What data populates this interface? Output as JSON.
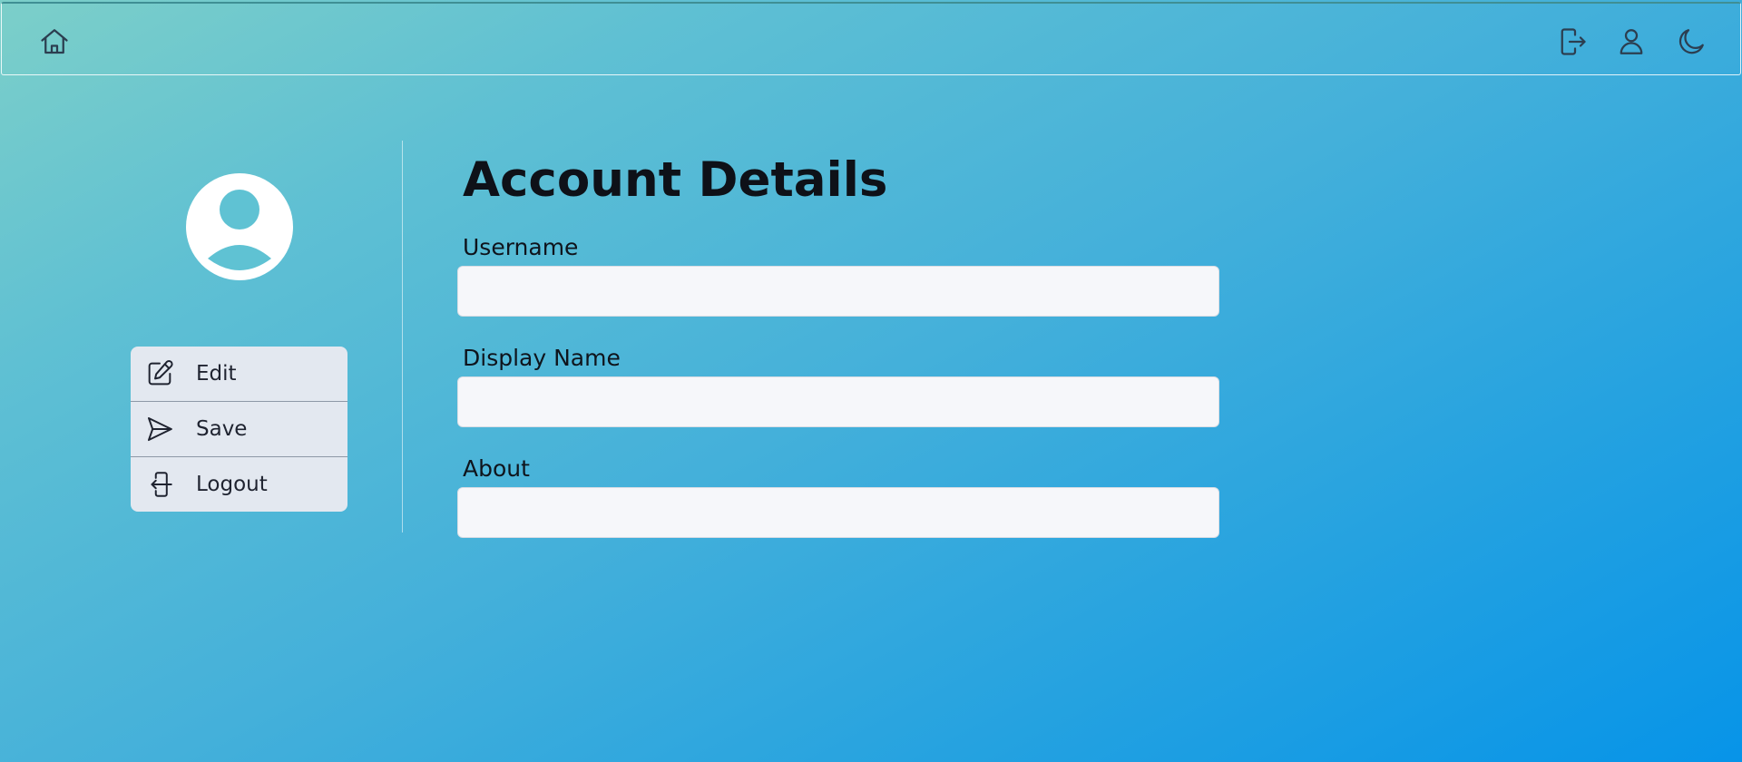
{
  "topbar": {
    "home_icon": "home-icon",
    "right_icons": [
      "logout-icon",
      "user-icon",
      "moon-icon"
    ]
  },
  "sidebar": {
    "avatar_icon": "user-circle-icon",
    "menu": [
      {
        "label": "Edit",
        "icon": "pencil-square-icon"
      },
      {
        "label": "Save",
        "icon": "send-icon"
      },
      {
        "label": "Logout",
        "icon": "logout-arrow-icon"
      }
    ]
  },
  "main": {
    "title": "Account Details",
    "fields": [
      {
        "label": "Username",
        "value": "",
        "placeholder": ""
      },
      {
        "label": "Display Name",
        "value": "",
        "placeholder": ""
      },
      {
        "label": "About",
        "value": "",
        "placeholder": ""
      }
    ]
  },
  "colors": {
    "gradient_start": "#7ccfc9",
    "gradient_end": "#0794e8",
    "menu_bg": "#e3e8f0",
    "input_bg": "#f6f7fa",
    "text_dark": "#0e1118"
  }
}
